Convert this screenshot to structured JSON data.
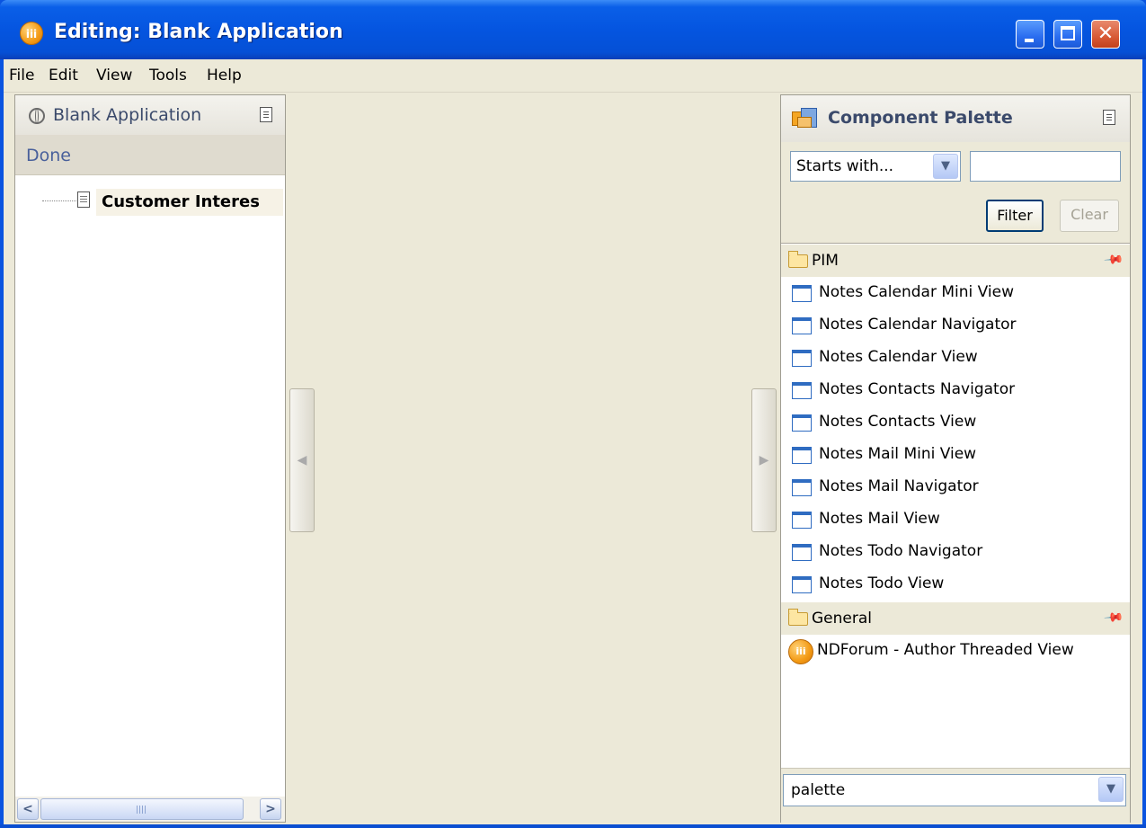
{
  "window": {
    "title": "Editing: Blank Application",
    "app_icon_glyph": "iii",
    "controls": {
      "minimize": "minimize-icon",
      "maximize": "maximize-icon",
      "close": "✕"
    }
  },
  "menubar": {
    "items": [
      "File",
      "Edit",
      "View",
      "Tools",
      "Help"
    ]
  },
  "left_panel": {
    "title": "Blank Application",
    "done_label": "Done",
    "tree": [
      {
        "label": "Customer Interes",
        "icon": "document-icon"
      }
    ],
    "scrollbar": {
      "left_arrow": "<",
      "right_arrow": ">"
    }
  },
  "right_panel": {
    "title": "Component Palette",
    "filter": {
      "mode_selected": "Starts with...",
      "text_value": "",
      "filter_button": "Filter",
      "clear_button": "Clear"
    },
    "groups": [
      {
        "name": "PIM",
        "items": [
          "Notes Calendar Mini View",
          "Notes Calendar Navigator",
          "Notes Calendar View",
          "Notes Contacts Navigator",
          "Notes Contacts View",
          "Notes Mail Mini View",
          "Notes Mail Navigator",
          "Notes Mail View",
          "Notes Todo Navigator",
          "Notes Todo View"
        ]
      },
      {
        "name": "General",
        "items": [
          "NDForum - Author Threaded View"
        ]
      }
    ],
    "palette_selected": "palette"
  },
  "colors": {
    "titlebar": "#0555e0",
    "chrome": "#ece9d8",
    "panel_title": "#3b4a6b",
    "done_text": "#49609b"
  }
}
